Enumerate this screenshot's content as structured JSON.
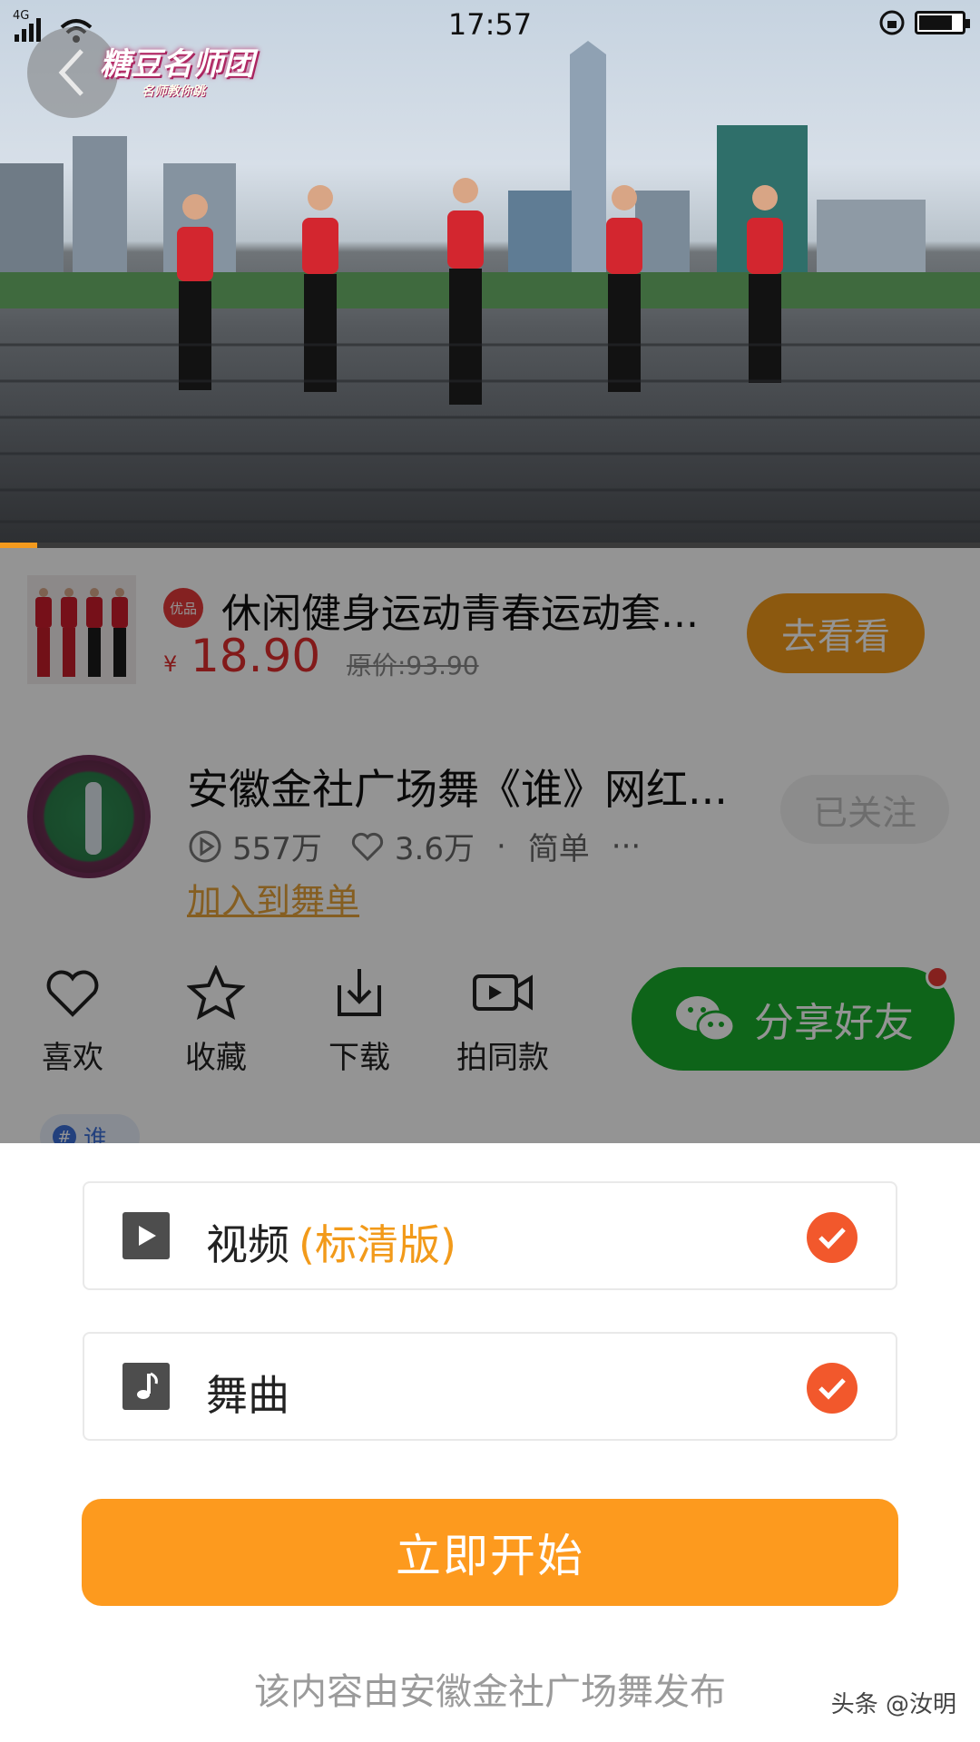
{
  "status_bar": {
    "time": "17:57",
    "network": "4G",
    "battery_level": 0.8
  },
  "video": {
    "channel_logo": "糖豆名师团",
    "channel_logo_sub": "名师教你跳",
    "progress": 0.038
  },
  "product": {
    "badge": "优品",
    "title": "休闲健身运动青春运动套...",
    "currency": "¥",
    "price": "18.90",
    "original_price": "原价:93.90",
    "go_label": "去看看"
  },
  "author": {
    "video_title": "安徽金社广场舞《谁》网红...",
    "plays": "557万",
    "likes": "3.6万",
    "separator": "·",
    "difficulty": "简单",
    "more": "···",
    "add_playlist": "加入到舞单",
    "follow_label": "已关注"
  },
  "actions": {
    "like": "喜欢",
    "favorite": "收藏",
    "download": "下载",
    "record_same": "拍同款",
    "share": "分享好友"
  },
  "tag": {
    "hash": "#",
    "label": "谁"
  },
  "download_sheet": {
    "options": [
      {
        "label": "视频",
        "sub": "(标清版)",
        "icon": "play-icon",
        "checked": true
      },
      {
        "label": "舞曲",
        "sub": "",
        "icon": "music-note-icon",
        "checked": true
      }
    ],
    "start_label": "立即开始",
    "publisher_note": "该内容由安徽金社广场舞发布",
    "watermark": "头条 @汝明"
  },
  "colors": {
    "accent_orange": "#fd9a1e",
    "check_red": "#f2582c",
    "wechat_green": "#19ad2b",
    "price_red": "#e02e2e"
  }
}
